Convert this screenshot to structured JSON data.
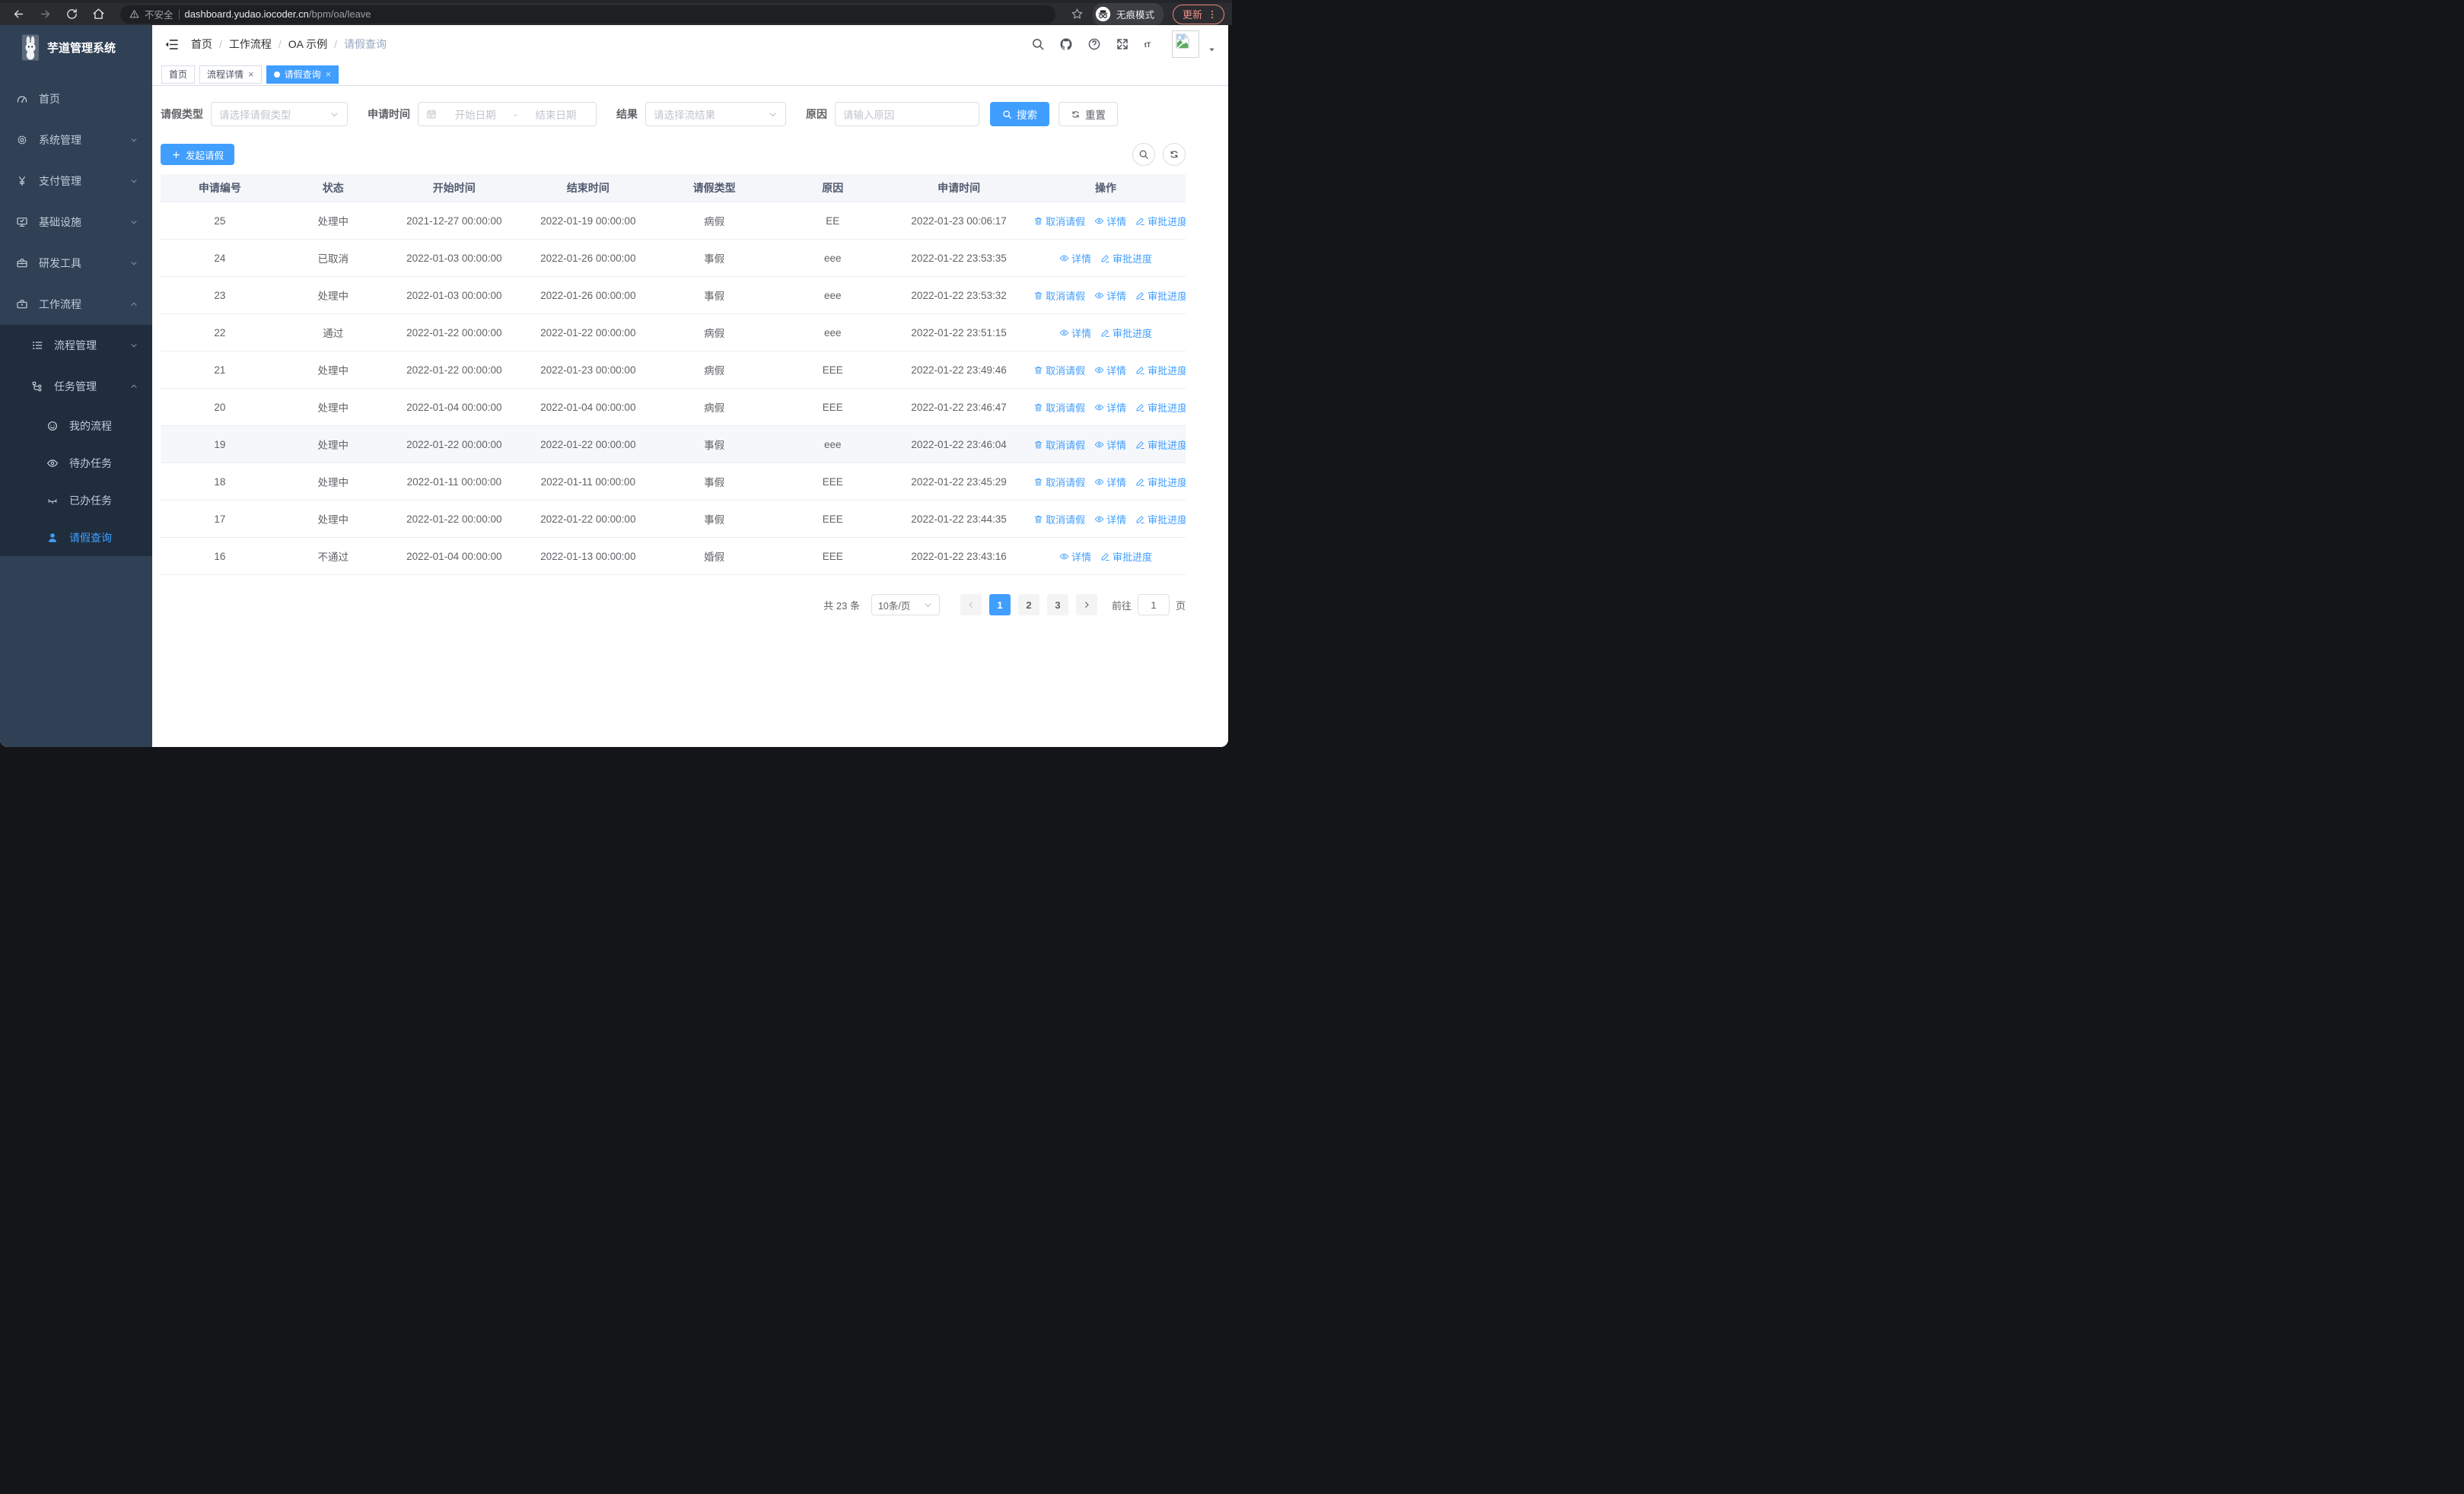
{
  "browser": {
    "security_label": "不安全",
    "url_host": "dashboard.yudao.iocoder.cn",
    "url_path": "/bpm/oa/leave",
    "incognito_label": "无痕模式",
    "update_label": "更新"
  },
  "sidebar": {
    "logo_title": "芋道管理系统",
    "items": [
      {
        "label": "首页",
        "icon": "dashboard-icon"
      },
      {
        "label": "系统管理",
        "icon": "gear-icon",
        "chevron": "down"
      },
      {
        "label": "支付管理",
        "icon": "yen-icon",
        "chevron": "down"
      },
      {
        "label": "基础设施",
        "icon": "monitor-icon",
        "chevron": "down"
      },
      {
        "label": "研发工具",
        "icon": "toolbox-icon",
        "chevron": "down"
      },
      {
        "label": "工作流程",
        "icon": "briefcase-icon",
        "chevron": "up"
      }
    ],
    "submenu": [
      {
        "label": "流程管理",
        "icon": "list-icon",
        "chevron": "down",
        "level": 2
      },
      {
        "label": "任务管理",
        "icon": "tree-icon",
        "chevron": "up",
        "level": 2
      },
      {
        "label": "我的流程",
        "icon": "robot-icon",
        "level": 3
      },
      {
        "label": "待办任务",
        "icon": "eye-icon",
        "level": 3
      },
      {
        "label": "已办任务",
        "icon": "eye-closed-icon",
        "level": 3
      },
      {
        "label": "请假查询",
        "icon": "user-icon",
        "level": 3,
        "active": true
      }
    ]
  },
  "header": {
    "breadcrumb": [
      "首页",
      "工作流程",
      "OA 示例",
      "请假查询"
    ]
  },
  "tabs": [
    {
      "label": "首页",
      "closable": false,
      "active": false
    },
    {
      "label": "流程详情",
      "closable": true,
      "active": false
    },
    {
      "label": "请假查询",
      "closable": true,
      "active": true
    }
  ],
  "filters": {
    "type_label": "请假类型",
    "type_placeholder": "请选择请假类型",
    "time_label": "申请时间",
    "start_placeholder": "开始日期",
    "range_separator": "-",
    "end_placeholder": "结束日期",
    "result_label": "结果",
    "result_placeholder": "请选择流结果",
    "reason_label": "原因",
    "reason_placeholder": "请输入原因",
    "search_label": "搜索",
    "reset_label": "重置"
  },
  "toolbar": {
    "create_label": "发起请假"
  },
  "table": {
    "columns": [
      "申请编号",
      "状态",
      "开始时间",
      "结束时间",
      "请假类型",
      "原因",
      "申请时间",
      "操作"
    ],
    "action_labels": {
      "cancel": "取消请假",
      "detail": "详情",
      "progress": "审批进度"
    },
    "rows": [
      {
        "id": "25",
        "status": "处理中",
        "start": "2021-12-27 00:00:00",
        "end": "2022-01-19 00:00:00",
        "type": "病假",
        "reason": "EE",
        "applied": "2022-01-23 00:06:17",
        "actions": [
          "cancel",
          "detail",
          "progress"
        ]
      },
      {
        "id": "24",
        "status": "已取消",
        "start": "2022-01-03 00:00:00",
        "end": "2022-01-26 00:00:00",
        "type": "事假",
        "reason": "eee",
        "applied": "2022-01-22 23:53:35",
        "actions": [
          "detail",
          "progress"
        ]
      },
      {
        "id": "23",
        "status": "处理中",
        "start": "2022-01-03 00:00:00",
        "end": "2022-01-26 00:00:00",
        "type": "事假",
        "reason": "eee",
        "applied": "2022-01-22 23:53:32",
        "actions": [
          "cancel",
          "detail",
          "progress"
        ]
      },
      {
        "id": "22",
        "status": "通过",
        "start": "2022-01-22 00:00:00",
        "end": "2022-01-22 00:00:00",
        "type": "病假",
        "reason": "eee",
        "applied": "2022-01-22 23:51:15",
        "actions": [
          "detail",
          "progress"
        ]
      },
      {
        "id": "21",
        "status": "处理中",
        "start": "2022-01-22 00:00:00",
        "end": "2022-01-23 00:00:00",
        "type": "病假",
        "reason": "EEE",
        "applied": "2022-01-22 23:49:46",
        "actions": [
          "cancel",
          "detail",
          "progress"
        ]
      },
      {
        "id": "20",
        "status": "处理中",
        "start": "2022-01-04 00:00:00",
        "end": "2022-01-04 00:00:00",
        "type": "病假",
        "reason": "EEE",
        "applied": "2022-01-22 23:46:47",
        "actions": [
          "cancel",
          "detail",
          "progress"
        ]
      },
      {
        "id": "19",
        "status": "处理中",
        "start": "2022-01-22 00:00:00",
        "end": "2022-01-22 00:00:00",
        "type": "事假",
        "reason": "eee",
        "applied": "2022-01-22 23:46:04",
        "actions": [
          "cancel",
          "detail",
          "progress"
        ],
        "highlight": true
      },
      {
        "id": "18",
        "status": "处理中",
        "start": "2022-01-11 00:00:00",
        "end": "2022-01-11 00:00:00",
        "type": "事假",
        "reason": "EEE",
        "applied": "2022-01-22 23:45:29",
        "actions": [
          "cancel",
          "detail",
          "progress"
        ]
      },
      {
        "id": "17",
        "status": "处理中",
        "start": "2022-01-22 00:00:00",
        "end": "2022-01-22 00:00:00",
        "type": "事假",
        "reason": "EEE",
        "applied": "2022-01-22 23:44:35",
        "actions": [
          "cancel",
          "detail",
          "progress"
        ]
      },
      {
        "id": "16",
        "status": "不通过",
        "start": "2022-01-04 00:00:00",
        "end": "2022-01-13 00:00:00",
        "type": "婚假",
        "reason": "EEE",
        "applied": "2022-01-22 23:43:16",
        "actions": [
          "detail",
          "progress"
        ]
      }
    ]
  },
  "pagination": {
    "total_label": "共 23 条",
    "page_size": "10条/页",
    "pages": [
      "1",
      "2",
      "3"
    ],
    "active_page": "1",
    "goto_label": "前往",
    "goto_value": "1",
    "page_suffix": "页"
  },
  "colors": {
    "primary": "#409eff",
    "sidebar_bg": "#304156",
    "submenu_bg": "#1f2d3d",
    "update_accent": "#ee9089"
  }
}
